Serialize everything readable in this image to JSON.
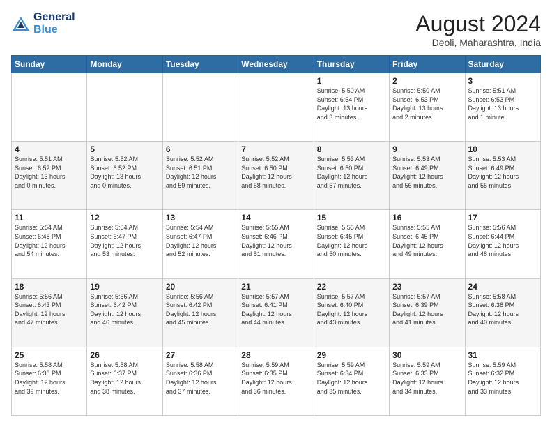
{
  "header": {
    "logo_line1": "General",
    "logo_line2": "Blue",
    "title": "August 2024",
    "location": "Deoli, Maharashtra, India"
  },
  "days_of_week": [
    "Sunday",
    "Monday",
    "Tuesday",
    "Wednesday",
    "Thursday",
    "Friday",
    "Saturday"
  ],
  "weeks": [
    [
      {
        "day": "",
        "text": ""
      },
      {
        "day": "",
        "text": ""
      },
      {
        "day": "",
        "text": ""
      },
      {
        "day": "",
        "text": ""
      },
      {
        "day": "1",
        "text": "Sunrise: 5:50 AM\nSunset: 6:54 PM\nDaylight: 13 hours\nand 3 minutes."
      },
      {
        "day": "2",
        "text": "Sunrise: 5:50 AM\nSunset: 6:53 PM\nDaylight: 13 hours\nand 2 minutes."
      },
      {
        "day": "3",
        "text": "Sunrise: 5:51 AM\nSunset: 6:53 PM\nDaylight: 13 hours\nand 1 minute."
      }
    ],
    [
      {
        "day": "4",
        "text": "Sunrise: 5:51 AM\nSunset: 6:52 PM\nDaylight: 13 hours\nand 0 minutes."
      },
      {
        "day": "5",
        "text": "Sunrise: 5:52 AM\nSunset: 6:52 PM\nDaylight: 13 hours\nand 0 minutes."
      },
      {
        "day": "6",
        "text": "Sunrise: 5:52 AM\nSunset: 6:51 PM\nDaylight: 12 hours\nand 59 minutes."
      },
      {
        "day": "7",
        "text": "Sunrise: 5:52 AM\nSunset: 6:50 PM\nDaylight: 12 hours\nand 58 minutes."
      },
      {
        "day": "8",
        "text": "Sunrise: 5:53 AM\nSunset: 6:50 PM\nDaylight: 12 hours\nand 57 minutes."
      },
      {
        "day": "9",
        "text": "Sunrise: 5:53 AM\nSunset: 6:49 PM\nDaylight: 12 hours\nand 56 minutes."
      },
      {
        "day": "10",
        "text": "Sunrise: 5:53 AM\nSunset: 6:49 PM\nDaylight: 12 hours\nand 55 minutes."
      }
    ],
    [
      {
        "day": "11",
        "text": "Sunrise: 5:54 AM\nSunset: 6:48 PM\nDaylight: 12 hours\nand 54 minutes."
      },
      {
        "day": "12",
        "text": "Sunrise: 5:54 AM\nSunset: 6:47 PM\nDaylight: 12 hours\nand 53 minutes."
      },
      {
        "day": "13",
        "text": "Sunrise: 5:54 AM\nSunset: 6:47 PM\nDaylight: 12 hours\nand 52 minutes."
      },
      {
        "day": "14",
        "text": "Sunrise: 5:55 AM\nSunset: 6:46 PM\nDaylight: 12 hours\nand 51 minutes."
      },
      {
        "day": "15",
        "text": "Sunrise: 5:55 AM\nSunset: 6:45 PM\nDaylight: 12 hours\nand 50 minutes."
      },
      {
        "day": "16",
        "text": "Sunrise: 5:55 AM\nSunset: 6:45 PM\nDaylight: 12 hours\nand 49 minutes."
      },
      {
        "day": "17",
        "text": "Sunrise: 5:56 AM\nSunset: 6:44 PM\nDaylight: 12 hours\nand 48 minutes."
      }
    ],
    [
      {
        "day": "18",
        "text": "Sunrise: 5:56 AM\nSunset: 6:43 PM\nDaylight: 12 hours\nand 47 minutes."
      },
      {
        "day": "19",
        "text": "Sunrise: 5:56 AM\nSunset: 6:42 PM\nDaylight: 12 hours\nand 46 minutes."
      },
      {
        "day": "20",
        "text": "Sunrise: 5:56 AM\nSunset: 6:42 PM\nDaylight: 12 hours\nand 45 minutes."
      },
      {
        "day": "21",
        "text": "Sunrise: 5:57 AM\nSunset: 6:41 PM\nDaylight: 12 hours\nand 44 minutes."
      },
      {
        "day": "22",
        "text": "Sunrise: 5:57 AM\nSunset: 6:40 PM\nDaylight: 12 hours\nand 43 minutes."
      },
      {
        "day": "23",
        "text": "Sunrise: 5:57 AM\nSunset: 6:39 PM\nDaylight: 12 hours\nand 41 minutes."
      },
      {
        "day": "24",
        "text": "Sunrise: 5:58 AM\nSunset: 6:38 PM\nDaylight: 12 hours\nand 40 minutes."
      }
    ],
    [
      {
        "day": "25",
        "text": "Sunrise: 5:58 AM\nSunset: 6:38 PM\nDaylight: 12 hours\nand 39 minutes."
      },
      {
        "day": "26",
        "text": "Sunrise: 5:58 AM\nSunset: 6:37 PM\nDaylight: 12 hours\nand 38 minutes."
      },
      {
        "day": "27",
        "text": "Sunrise: 5:58 AM\nSunset: 6:36 PM\nDaylight: 12 hours\nand 37 minutes."
      },
      {
        "day": "28",
        "text": "Sunrise: 5:59 AM\nSunset: 6:35 PM\nDaylight: 12 hours\nand 36 minutes."
      },
      {
        "day": "29",
        "text": "Sunrise: 5:59 AM\nSunset: 6:34 PM\nDaylight: 12 hours\nand 35 minutes."
      },
      {
        "day": "30",
        "text": "Sunrise: 5:59 AM\nSunset: 6:33 PM\nDaylight: 12 hours\nand 34 minutes."
      },
      {
        "day": "31",
        "text": "Sunrise: 5:59 AM\nSunset: 6:32 PM\nDaylight: 12 hours\nand 33 minutes."
      }
    ]
  ]
}
